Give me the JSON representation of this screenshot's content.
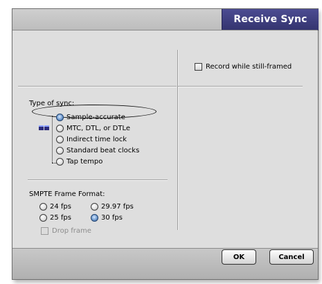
{
  "dialog": {
    "title": "Receive Sync"
  },
  "record_option": {
    "label": "Record while still-framed",
    "checked": false
  },
  "sync_type": {
    "heading": "Type of sync:",
    "options": [
      {
        "label": "Sample-accurate",
        "selected": true
      },
      {
        "label": "MTC, DTL, or DTLe",
        "selected": false
      },
      {
        "label": "Indirect time lock",
        "selected": false
      },
      {
        "label": "Standard beat clocks",
        "selected": false
      },
      {
        "label": "Tap tempo",
        "selected": false
      }
    ]
  },
  "smpte": {
    "heading": "SMPTE Frame Format:",
    "options": [
      {
        "label": "24 fps",
        "selected": false
      },
      {
        "label": "29.97 fps",
        "selected": false
      },
      {
        "label": "25 fps",
        "selected": false
      },
      {
        "label": "30 fps",
        "selected": true
      }
    ],
    "drop_frame": {
      "label": "Drop frame",
      "checked": false,
      "enabled": false
    }
  },
  "buttons": {
    "ok": "OK",
    "cancel": "Cancel"
  },
  "colors": {
    "title_tab": "#3c3c7e",
    "content_bg": "#dedede",
    "radio_selected": "#4f7fc0"
  }
}
